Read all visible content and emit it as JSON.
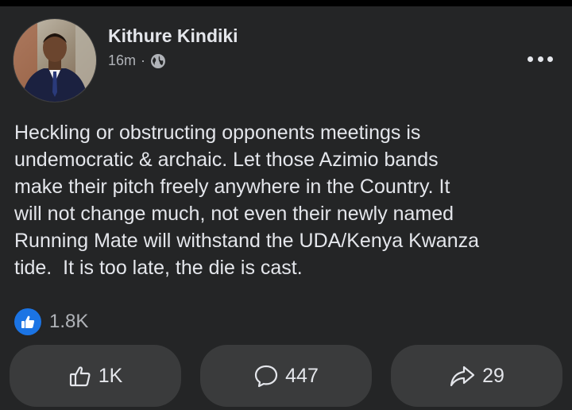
{
  "post": {
    "author_name": "Kithure Kindiki",
    "time": "16m",
    "separator": "·",
    "privacy_icon": "globe-icon",
    "text": "Heckling or obstructing opponents meetings is\nundemocratic & archaic. Let those Azimio bands\nmake their pitch freely anywhere in the Country. It\nwill not change much, not even their newly named\nRunning Mate will withstand the UDA/Kenya Kwanza\ntide.  It is too late, the die is cast."
  },
  "reactions": {
    "icon": "like-reaction-icon",
    "count": "1.8K"
  },
  "actions": {
    "like_count": "1K",
    "comment_count": "447",
    "share_count": "29"
  },
  "colors": {
    "background": "#242526",
    "button": "#3a3b3c",
    "like_blue": "#1b74e4",
    "text_primary": "#e4e6eb",
    "text_secondary": "#b0b3b8"
  }
}
